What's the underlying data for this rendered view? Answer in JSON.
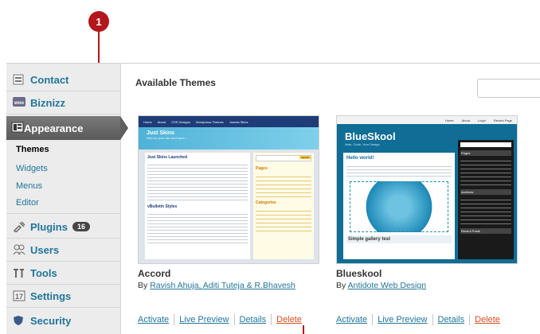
{
  "sidebar": {
    "items": [
      {
        "label": "Contact",
        "icon": "contact-icon"
      },
      {
        "label": "Biznizz",
        "icon": "woo-icon"
      },
      {
        "label": "Appearance",
        "icon": "appearance-icon"
      },
      {
        "label": "Plugins",
        "icon": "plugins-icon",
        "badge": "16"
      },
      {
        "label": "Users",
        "icon": "users-icon"
      },
      {
        "label": "Tools",
        "icon": "tools-icon"
      },
      {
        "label": "Settings",
        "icon": "settings-icon"
      },
      {
        "label": "Security",
        "icon": "security-icon"
      }
    ],
    "submenu": [
      "Themes",
      "Widgets",
      "Menus",
      "Editor"
    ]
  },
  "main": {
    "title": "Available Themes",
    "themes": [
      {
        "name": "Accord",
        "by_prefix": "By",
        "author": "Ravish Ahuja, Aditi Tuteja & R.Bhavesh",
        "actions": [
          "Activate",
          "Live Preview",
          "Details",
          "Delete"
        ],
        "preview": {
          "nav": [
            "Home",
            "About",
            "CSS Designs",
            "Wordpress Themes",
            "Joomla Skins"
          ],
          "header_title": "Just Skins",
          "header_sub": "Skin for your site and more ...",
          "post1": "Just Skins Launched",
          "widget_title": "Pages",
          "widget_title2": "Categories",
          "post2": "vBulletin Styles",
          "search_btn": "Search"
        }
      },
      {
        "name": "Blueskool",
        "by_prefix": "By",
        "author": "Antidote Web Design",
        "actions": [
          "Activate",
          "Live Preview",
          "Details",
          "Delete"
        ],
        "preview": {
          "nav": [
            "Home",
            "About",
            "Login",
            "Recent Page"
          ],
          "logo": "BlueSkool",
          "tagline": "Web, Code, Your Design",
          "post1": "Hello world!",
          "post2": "Simple gallery test",
          "widget1": "Pages",
          "widget2": "Archives",
          "widget3": "Recent Posts"
        }
      }
    ]
  },
  "callout": {
    "number": "1"
  },
  "colors": {
    "link": "#21759b",
    "delete": "#d54e21",
    "callout": "#b3161b"
  }
}
